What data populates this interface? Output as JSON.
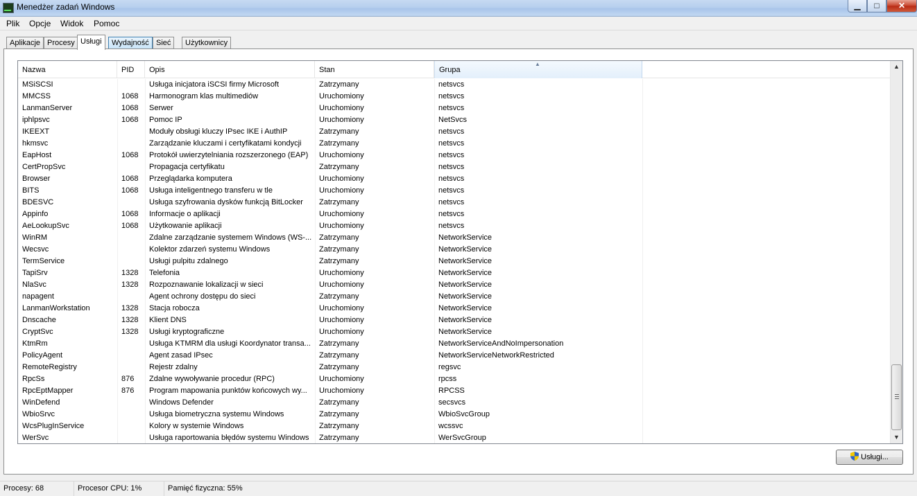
{
  "window": {
    "title": "Menedżer zadań Windows",
    "min_symbol": "▁",
    "max_symbol": "□",
    "close_symbol": "✕"
  },
  "menu": [
    "Plik",
    "Opcje",
    "Widok",
    "Pomoc"
  ],
  "tabs": [
    "Aplikacje",
    "Procesy",
    "Usługi",
    "Wydajność",
    "Sieć",
    "Użytkownicy"
  ],
  "active_tab": "Usługi",
  "columns": [
    "Nazwa",
    "PID",
    "Opis",
    "Stan",
    "Grupa"
  ],
  "sorted_column": "Grupa",
  "rows": [
    [
      "MSiSCSI",
      "",
      "Usługa inicjatora iSCSI firmy Microsoft",
      "Zatrzymany",
      "netsvcs"
    ],
    [
      "MMCSS",
      "1068",
      "Harmonogram klas multimediów",
      "Uruchomiony",
      "netsvcs"
    ],
    [
      "LanmanServer",
      "1068",
      "Serwer",
      "Uruchomiony",
      "netsvcs"
    ],
    [
      "iphlpsvc",
      "1068",
      "Pomoc IP",
      "Uruchomiony",
      "NetSvcs"
    ],
    [
      "IKEEXT",
      "",
      "Moduły obsługi kluczy IPsec IKE i AuthIP",
      "Zatrzymany",
      "netsvcs"
    ],
    [
      "hkmsvc",
      "",
      "Zarządzanie kluczami i certyfikatami kondycji",
      "Zatrzymany",
      "netsvcs"
    ],
    [
      "EapHost",
      "1068",
      "Protokół uwierzytelniania rozszerzonego (EAP)",
      "Uruchomiony",
      "netsvcs"
    ],
    [
      "CertPropSvc",
      "",
      "Propagacja certyfikatu",
      "Zatrzymany",
      "netsvcs"
    ],
    [
      "Browser",
      "1068",
      "Przeglądarka komputera",
      "Uruchomiony",
      "netsvcs"
    ],
    [
      "BITS",
      "1068",
      "Usługa inteligentnego transferu w tle",
      "Uruchomiony",
      "netsvcs"
    ],
    [
      "BDESVC",
      "",
      "Usługa szyfrowania dysków funkcją BitLocker",
      "Zatrzymany",
      "netsvcs"
    ],
    [
      "Appinfo",
      "1068",
      "Informacje o aplikacji",
      "Uruchomiony",
      "netsvcs"
    ],
    [
      "AeLookupSvc",
      "1068",
      "Użytkowanie aplikacji",
      "Uruchomiony",
      "netsvcs"
    ],
    [
      "WinRM",
      "",
      "Zdalne zarządzanie systemem Windows (WS-...",
      "Zatrzymany",
      "NetworkService"
    ],
    [
      "Wecsvc",
      "",
      "Kolektor zdarzeń systemu Windows",
      "Zatrzymany",
      "NetworkService"
    ],
    [
      "TermService",
      "",
      "Usługi pulpitu zdalnego",
      "Zatrzymany",
      "NetworkService"
    ],
    [
      "TapiSrv",
      "1328",
      "Telefonia",
      "Uruchomiony",
      "NetworkService"
    ],
    [
      "NlaSvc",
      "1328",
      "Rozpoznawanie lokalizacji w sieci",
      "Uruchomiony",
      "NetworkService"
    ],
    [
      "napagent",
      "",
      "Agent ochrony dostępu do sieci",
      "Zatrzymany",
      "NetworkService"
    ],
    [
      "LanmanWorkstation",
      "1328",
      "Stacja robocza",
      "Uruchomiony",
      "NetworkService"
    ],
    [
      "Dnscache",
      "1328",
      "Klient DNS",
      "Uruchomiony",
      "NetworkService"
    ],
    [
      "CryptSvc",
      "1328",
      "Usługi kryptograficzne",
      "Uruchomiony",
      "NetworkService"
    ],
    [
      "KtmRm",
      "",
      "Usługa KTMRM dla usługi Koordynator transa...",
      "Zatrzymany",
      "NetworkServiceAndNoImpersonation"
    ],
    [
      "PolicyAgent",
      "",
      "Agent zasad IPsec",
      "Zatrzymany",
      "NetworkServiceNetworkRestricted"
    ],
    [
      "RemoteRegistry",
      "",
      "Rejestr zdalny",
      "Zatrzymany",
      "regsvc"
    ],
    [
      "RpcSs",
      "876",
      "Zdalne wywoływanie procedur (RPC)",
      "Uruchomiony",
      "rpcss"
    ],
    [
      "RpcEptMapper",
      "876",
      "Program mapowania punktów końcowych wy...",
      "Uruchomiony",
      "RPCSS"
    ],
    [
      "WinDefend",
      "",
      "Windows Defender",
      "Zatrzymany",
      "secsvcs"
    ],
    [
      "WbioSrvc",
      "",
      "Usługa biometryczna systemu Windows",
      "Zatrzymany",
      "WbioSvcGroup"
    ],
    [
      "WcsPlugInService",
      "",
      "Kolory w systemie Windows",
      "Zatrzymany",
      "wcssvc"
    ],
    [
      "WerSvc",
      "",
      "Usługa raportowania błędów systemu Windows",
      "Zatrzymany",
      "WerSvcGroup"
    ]
  ],
  "services_button": "Usługi...",
  "status": {
    "processes": "Procesy: 68",
    "cpu": "Procesor CPU: 1%",
    "memory": "Pamięć fizyczna: 55%"
  },
  "colors": {
    "titlebar": "#b7cfee",
    "close": "#c7442c",
    "tab_hover": "#c6e4f8",
    "sorted_header": "#e3effb"
  },
  "icons": {
    "sort": "sort-ascending-icon",
    "scroll_up": "scroll-up-arrow-icon",
    "scroll_down": "scroll-down-arrow-icon",
    "shield": "uac-shield-icon"
  }
}
